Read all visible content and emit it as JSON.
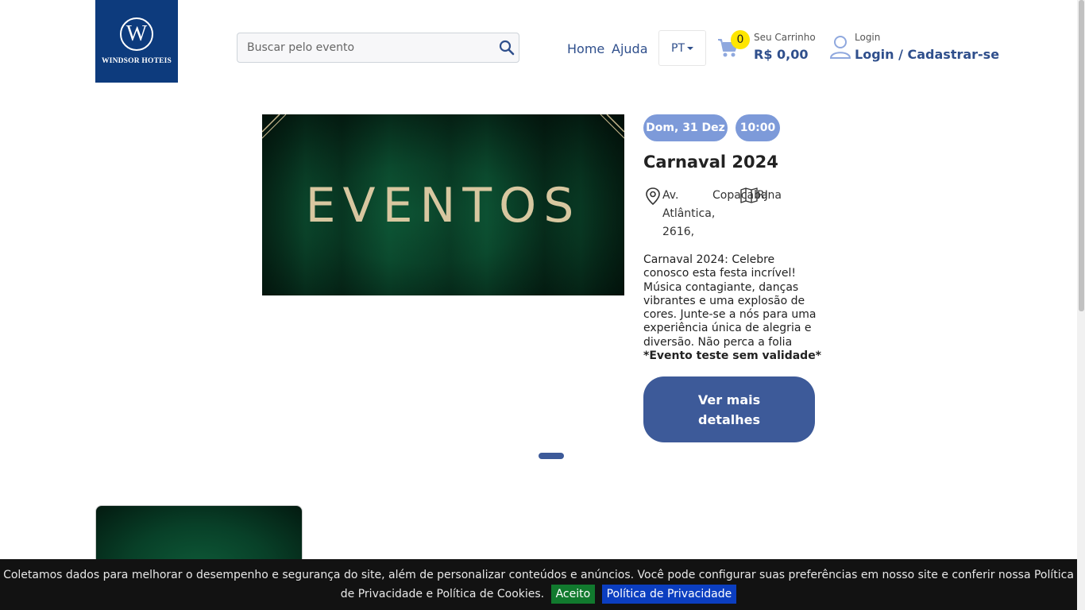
{
  "header": {
    "logo_text": "WINDSOR HOTEIS",
    "logo_letter": "W",
    "search_placeholder": "Buscar pelo evento",
    "nav": [
      "Home",
      "Ajuda"
    ],
    "language": "PT",
    "cart": {
      "count": "0",
      "label": "Seu Carrinho",
      "total": "R$ 0,00"
    },
    "login": {
      "label": "Login",
      "link": "Login / Cadastrar-se"
    }
  },
  "event": {
    "image_title": "EVENTOS",
    "date": "Dom, 31 Dez",
    "time": "10:00",
    "title": "Carnaval 2024",
    "address_1": "Av. Atlântica, 2616,",
    "address_2": "Copacabana",
    "address_3": "RJ",
    "description": "Carnaval 2024: Celebre conosco esta festa incrível! Música contagiante, danças vibrantes e uma explosão de cores. Junte-se a nós para uma experiência única de alegria e diversão. Não perca a folia",
    "description_strong": "*Evento teste sem validade*",
    "cta": "Ver mais detalhes"
  },
  "cookie": {
    "text": "Coletamos dados para melhorar o desempenho e segurança do site, além de personalizar conteúdos e anúncios. Você pode configurar suas preferências em nosso site e conferir nossa Política de Privacidade e Política de Cookies.",
    "accept": "Aceito",
    "policy": "Política de Privacidade"
  },
  "colors": {
    "primary": "#2f4f8c",
    "button": "#3d5a99",
    "badge": "#7d9ad9",
    "logo_bg": "#0d3b7d",
    "cart_badge": "#ffe600",
    "accept_bg": "#117a2e",
    "policy_bg": "#0b3ec0"
  },
  "icons": [
    "search-icon",
    "cart-icon",
    "user-icon",
    "location-pin-icon",
    "map-icon",
    "chevron-down-icon"
  ]
}
